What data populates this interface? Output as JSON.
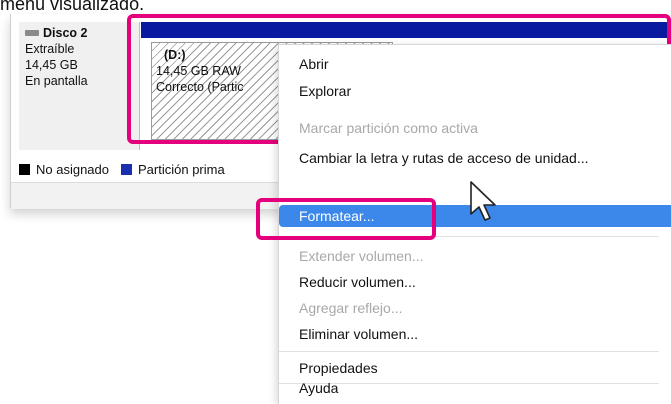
{
  "caption": "menú visualizado.",
  "disk": {
    "name": "Disco 2",
    "type": "Extraíble",
    "size": "14,45 GB",
    "status": "En pantalla"
  },
  "volume": {
    "label": "(D:)",
    "size_fs": "14,45 GB RAW",
    "health": "Correcto (Partic"
  },
  "legend": {
    "unallocated": "No asignado",
    "primary": "Partición prima"
  },
  "menu": {
    "items": [
      {
        "label": "Abrir",
        "enabled": true
      },
      {
        "label": "Explorar",
        "enabled": true
      },
      {
        "label": "Marcar partición como activa",
        "enabled": false
      },
      {
        "label": "Cambiar la letra y rutas de acceso de unidad...",
        "enabled": true
      },
      {
        "label": "Formatear...",
        "enabled": true,
        "highlighted": true
      },
      {
        "label": "Extender volumen...",
        "enabled": false
      },
      {
        "label": "Reducir volumen...",
        "enabled": true
      },
      {
        "label": "Agregar reflejo...",
        "enabled": false
      },
      {
        "label": "Eliminar volumen...",
        "enabled": true
      },
      {
        "label": "Propiedades",
        "enabled": true
      },
      {
        "label": "Ayuda",
        "enabled": true
      }
    ]
  },
  "colors": {
    "highlight": "#e4007c",
    "menu_selection": "#3b88ea",
    "volume_header": "#0a1aa0"
  }
}
